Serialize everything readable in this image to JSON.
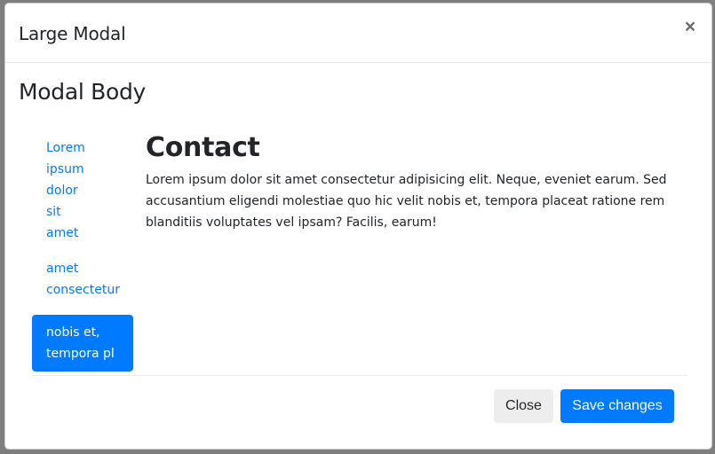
{
  "modal": {
    "title": "Large Modal",
    "close_icon": "×"
  },
  "body": {
    "title": "Modal Body",
    "nav": [
      {
        "label": "Lorem ipsum dolor sit amet",
        "active": false
      },
      {
        "label": "amet consectetur",
        "active": false
      },
      {
        "label": "nobis et, tempora pl",
        "active": true
      }
    ],
    "content": {
      "title": "Contact",
      "text": "Lorem ipsum dolor sit amet consectetur adipisicing elit. Neque, eveniet earum. Sed accusantium eligendi molestiae quo hic velit nobis et, tempora placeat ratione rem blanditiis voluptates vel ipsam? Facilis, earum!"
    }
  },
  "footer": {
    "close_label": "Close",
    "save_label": "Save changes"
  },
  "colors": {
    "accent": "#007bff",
    "backdrop": "#7f7f7f",
    "secondary_button": "#ededed"
  }
}
